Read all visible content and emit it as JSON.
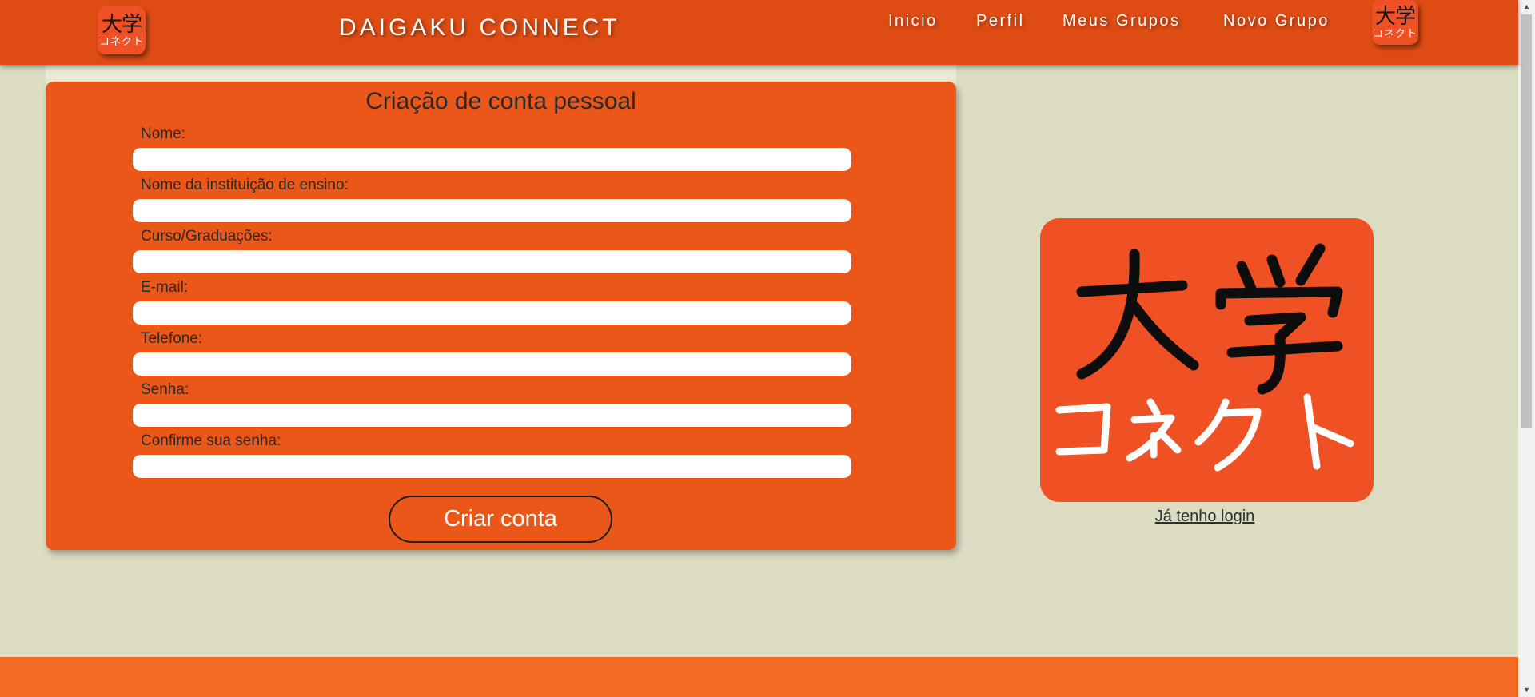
{
  "header": {
    "brand": "DAIGAKU CONNECT",
    "logo_kanji": "大学",
    "logo_kana": "コネクト",
    "nav": [
      {
        "label": "Inicio"
      },
      {
        "label": "Perfil"
      },
      {
        "label": "Meus Grupos"
      },
      {
        "label": "Novo Grupo"
      }
    ]
  },
  "form": {
    "title": "Criação de conta pessoal",
    "fields": [
      {
        "label": "Nome:",
        "value": ""
      },
      {
        "label": "Nome da instituição de ensino:",
        "value": ""
      },
      {
        "label": "Curso/Graduações:",
        "value": ""
      },
      {
        "label": "E-mail:",
        "value": ""
      },
      {
        "label": "Telefone:",
        "value": ""
      },
      {
        "label": "Senha:",
        "value": ""
      },
      {
        "label": "Confirme sua senha:",
        "value": ""
      }
    ],
    "submit_label": "Criar conta"
  },
  "side": {
    "logo_kanji": "大学",
    "logo_kana": "コネクト",
    "login_link": "Já tenho login"
  },
  "colors": {
    "header_bg": "#de4c14",
    "card_bg": "#ea5719",
    "logo_bg": "#ef5024",
    "page_bg": "#dcdcc2",
    "footer_bg": "#f26b22"
  }
}
